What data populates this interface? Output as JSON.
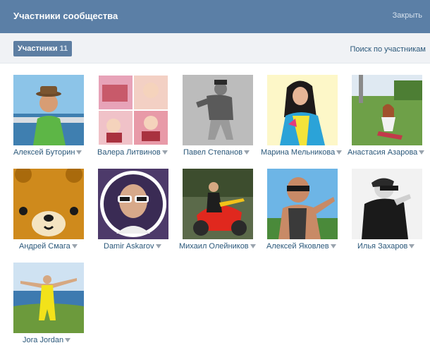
{
  "header": {
    "title": "Участники сообщества",
    "close_label": "Закрыть"
  },
  "tabs": {
    "active_label": "Участники",
    "active_count": "11",
    "search_link": "Поиск по участникам"
  },
  "members": [
    {
      "name": "Алексей Буторин"
    },
    {
      "name": "Валера Литвинов"
    },
    {
      "name": "Павел Степанов"
    },
    {
      "name": "Марина Мельникова"
    },
    {
      "name": "Анастасия Азарова"
    },
    {
      "name": "Андрей Смага"
    },
    {
      "name": "Damir Askarov"
    },
    {
      "name": "Михаил Олейников"
    },
    {
      "name": "Алексей Яковлев"
    },
    {
      "name": "Илья Захаров"
    },
    {
      "name": "Jora Jordan"
    }
  ]
}
